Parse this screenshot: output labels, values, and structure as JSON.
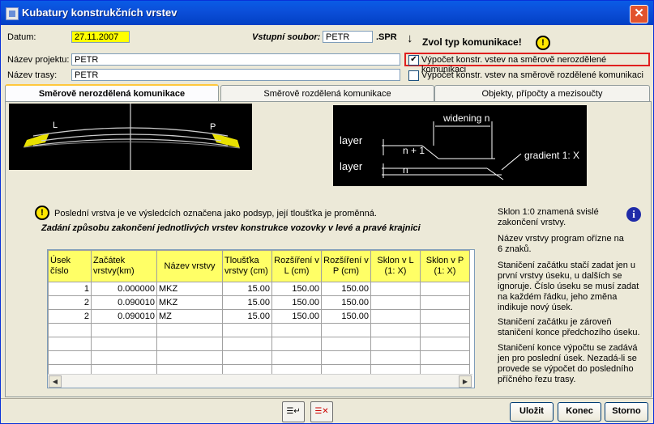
{
  "window": {
    "title": "Kubatury konstrukčních vrstev",
    "close": "✕"
  },
  "form": {
    "datum_label": "Datum:",
    "datum_value": "27.11.2007",
    "vstupni_label": "Vstupní soubor:",
    "vstupni_value": "PETR",
    "vstupni_ext": ".SPR",
    "projekt_label": "Název projektu:",
    "projekt_value": "PETR",
    "trasa_label": "Název trasy:",
    "trasa_value": "PETR",
    "zvol_label": "Zvol typ komunikace!",
    "opt1_label": "Výpočet konstr. vstev na směrově nerozdělené komunikaci",
    "opt1_checked": "✔",
    "opt2_label": "Výpočet konstr. vstev na směrově rozdělené komunikaci"
  },
  "tabs": [
    {
      "label": "Směrově nerozdělená komunikace"
    },
    {
      "label": "Směrově rozdělená komunikace"
    },
    {
      "label": "Objekty, přípočty a mezisoučty"
    }
  ],
  "diagram": {
    "left_label": "L",
    "right_label": "P",
    "layer1": "layer",
    "layer2": "layer",
    "n1": "n + 1",
    "n2": "n",
    "widening": "widening  n",
    "gradient": "gradient 1: X"
  },
  "notice": "Poslední vrstva je ve výsledcích označena jako podsyp, její tloušťka je proměnná.",
  "instruction": "Zadání způsobu zakončení jednotlivých vrstev konstrukce vozovky v levé a pravé krajnici",
  "table": {
    "headers": [
      "Úsek číslo",
      "Začátek vrstvy(km)",
      "Název vrstvy",
      "Tloušťka vrstvy (cm)",
      "Rozšíření v L (cm)",
      "Rozšíření v P (cm)",
      "Sklon v L (1: X)",
      "Sklon v P (1: X)"
    ],
    "rows": [
      [
        "1",
        "0.000000",
        "MKZ",
        "15.00",
        "150.00",
        "150.00",
        "",
        ""
      ],
      [
        "2",
        "0.090010",
        "MKZ",
        "15.00",
        "150.00",
        "150.00",
        "",
        ""
      ],
      [
        "2",
        "0.090010",
        "MZ",
        "15.00",
        "150.00",
        "150.00",
        "",
        ""
      ]
    ]
  },
  "help": [
    "Sklon 1:0  znamená svislé zakončení vrstvy.",
    "Název vrstvy program ořízne na 6 znaků.",
    "Staničení začátku stačí zadat jen u první vrstvy úseku, u dalších se ignoruje. Číslo úseku se musí zadat na každém řádku, jeho změna indikuje nový úsek.",
    "Staničení začátku je zároveň staničení konce předchozího úseku.",
    "Staničení konce výpočtu se zadává jen pro poslední úsek.  Nezadá-li se provede se výpočet do posledního příčného řezu trasy."
  ],
  "buttons": {
    "ulozit": "Uložit",
    "konec": "Konec",
    "storno": "Storno"
  },
  "colors": {
    "titlebar": "#0b4ed8",
    "header_yellow": "#ffff66",
    "highlight_red": "#e0201f"
  }
}
